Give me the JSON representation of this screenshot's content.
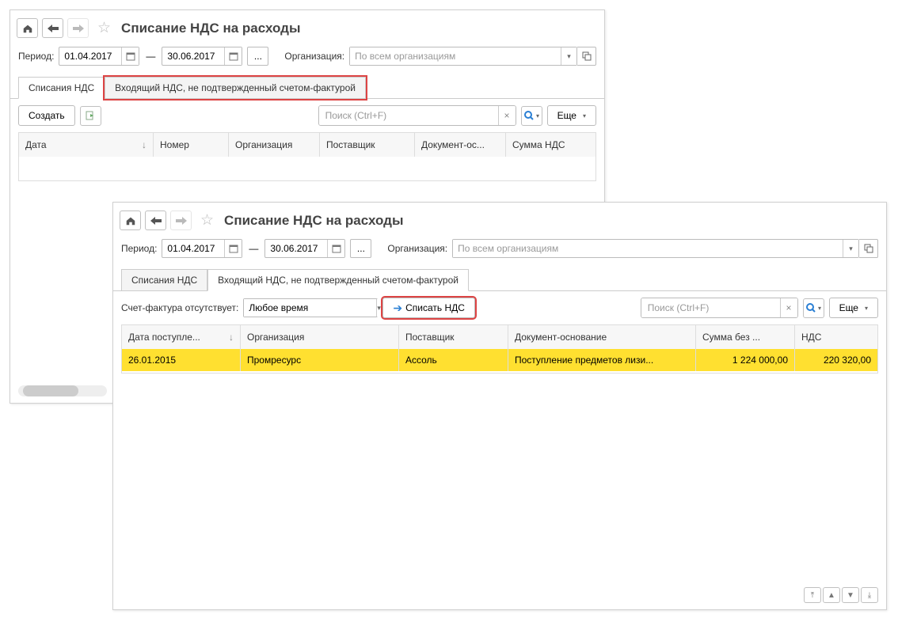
{
  "win1": {
    "title": "Списание НДС на расходы",
    "period_label": "Период:",
    "date_from": "01.04.2017",
    "date_to": "30.06.2017",
    "org_label": "Организация:",
    "org_placeholder": "По всем организациям",
    "tabs": {
      "t1": "Списания НДС",
      "t2": "Входящий НДС, не подтвержденный счетом-фактурой"
    },
    "toolbar": {
      "create": "Создать",
      "search_ph": "Поиск (Ctrl+F)",
      "more": "Еще"
    },
    "columns": {
      "date": "Дата",
      "number": "Номер",
      "org": "Организация",
      "supplier": "Поставщик",
      "doc": "Документ-ос...",
      "vat": "Сумма НДС"
    }
  },
  "win2": {
    "title": "Списание НДС на расходы",
    "period_label": "Период:",
    "date_from": "01.04.2017",
    "date_to": "30.06.2017",
    "org_label": "Организация:",
    "org_placeholder": "По всем организациям",
    "tabs": {
      "t1": "Списания НДС",
      "t2": "Входящий НДС, не подтвержденный счетом-фактурой"
    },
    "filter_label": "Счет-фактура отсутствует:",
    "filter_value": "Любое время",
    "write_off": "Списать НДС",
    "search_ph": "Поиск (Ctrl+F)",
    "more": "Еще",
    "columns": {
      "date": "Дата поступле...",
      "org": "Организация",
      "supplier": "Поставщик",
      "doc": "Документ-основание",
      "amount": "Сумма без ...",
      "vat": "НДС"
    },
    "row": {
      "date": "26.01.2015",
      "org": "Промресурс",
      "supplier": "Ассоль",
      "doc": "Поступление предметов лизи...",
      "amount": "1 224 000,00",
      "vat": "220 320,00"
    }
  }
}
